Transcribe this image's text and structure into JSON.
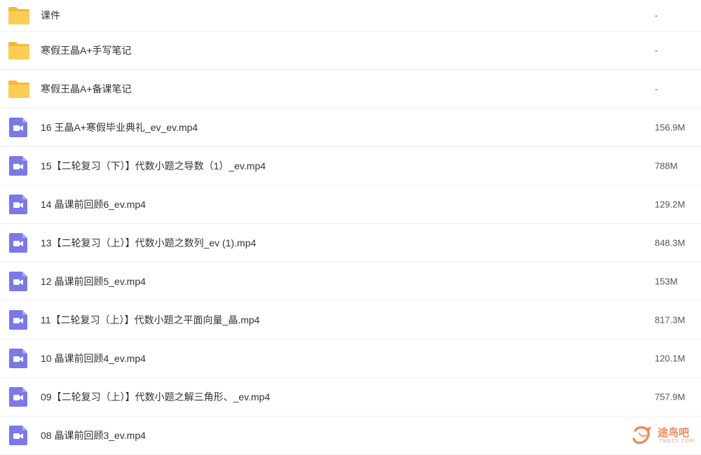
{
  "files": [
    {
      "type": "folder",
      "icon": "folder-icon",
      "name": "课件",
      "size": "-"
    },
    {
      "type": "folder",
      "icon": "folder-icon",
      "name": "寒假王晶A+手写笔记",
      "size": "-"
    },
    {
      "type": "folder",
      "icon": "folder-icon",
      "name": "寒假王晶A+备课笔记",
      "size": "-"
    },
    {
      "type": "video",
      "icon": "video-file-icon",
      "name": "16 王晶A+寒假毕业典礼_ev_ev.mp4",
      "size": "156.9M"
    },
    {
      "type": "video",
      "icon": "video-file-icon",
      "name": "15【二轮复习（下）】代数小题之导数（1）_ev.mp4",
      "size": "788M"
    },
    {
      "type": "video",
      "icon": "video-file-icon",
      "name": "14 晶课前回顾6_ev.mp4",
      "size": "129.2M"
    },
    {
      "type": "video",
      "icon": "video-file-icon",
      "name": "13【二轮复习（上）】代数小题之数列_ev (1).mp4",
      "size": "848.3M"
    },
    {
      "type": "video",
      "icon": "video-file-icon",
      "name": "12 晶课前回顾5_ev.mp4",
      "size": "153M"
    },
    {
      "type": "video",
      "icon": "video-file-icon",
      "name": "11【二轮复习（上）】代数小题之平面向量_晶.mp4",
      "size": "817.3M"
    },
    {
      "type": "video",
      "icon": "video-file-icon",
      "name": "10 晶课前回顾4_ev.mp4",
      "size": "120.1M"
    },
    {
      "type": "video",
      "icon": "video-file-icon",
      "name": "09【二轮复习（上）】代数小题之解三角形、_ev.mp4",
      "size": "757.9M"
    },
    {
      "type": "video",
      "icon": "video-file-icon",
      "name": "08 晶课前回顾3_ev.mp4",
      "size": ""
    }
  ],
  "watermark": {
    "text": "途鸟吧",
    "subtext": "TNBZS.COM"
  },
  "colors": {
    "folder": "#f8c94a",
    "video": "#7b78e8",
    "watermark": "#f08a5d"
  }
}
